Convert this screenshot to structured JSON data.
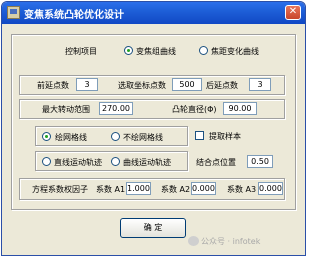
{
  "window": {
    "title": "变焦系统凸轮优化设计",
    "close_glyph": "✕"
  },
  "control": {
    "label": "控制项目",
    "options": [
      {
        "label": "变焦组曲线",
        "selected": true
      },
      {
        "label": "焦距变化曲线",
        "selected": false
      }
    ]
  },
  "params": {
    "front_ext_label": "前延点数",
    "front_ext_value": "3",
    "sample_label": "选取坐标点数",
    "sample_value": "500",
    "back_ext_label": "后延点数",
    "back_ext_value": "3"
  },
  "angles": {
    "max_rot_label": "最大转动范围",
    "max_rot_value": "270.00",
    "cam_dia_label": "凸轮直径(Φ)",
    "cam_dia_value": "90.00"
  },
  "grid": {
    "options": [
      {
        "label": "绘网格线",
        "selected": true
      },
      {
        "label": "不绘网格线",
        "selected": false
      }
    ],
    "extract_label": "提取样本",
    "extract_checked": false
  },
  "motion": {
    "options": [
      {
        "label": "直线运动轨迹",
        "selected": false
      },
      {
        "label": "曲线运动轨迹",
        "selected": false
      }
    ],
    "junction_label": "结合点位置",
    "junction_value": "0.50"
  },
  "coeffs": {
    "label": "方程系数权因子",
    "a1_label": "系数 A1",
    "a1_value": "1.000",
    "a2_label": "系数 A2",
    "a2_value": "0.000",
    "a3_label": "系数 A3",
    "a3_value": "0.000"
  },
  "actions": {
    "ok_label": "确  定"
  },
  "watermark": {
    "text": "公众号 · infotek"
  }
}
